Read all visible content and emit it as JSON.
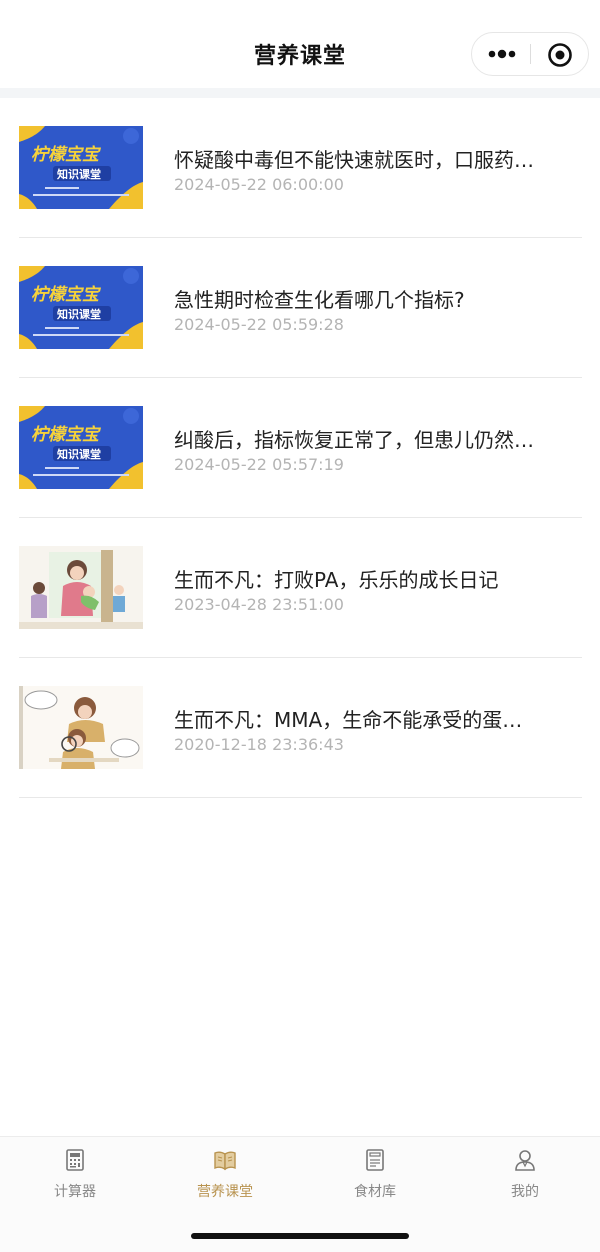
{
  "header": {
    "title": "营养课堂"
  },
  "list": {
    "items": [
      {
        "title": "怀疑酸中毒但不能快速就医时，口服药…",
        "date": "2024-05-22 06:00:00",
        "thumb": {
          "type": "banner",
          "text_main": "柠檬宝宝",
          "text_sub": "知识课堂"
        }
      },
      {
        "title": "急性期时检查生化看哪几个指标?",
        "date": "2024-05-22 05:59:28",
        "thumb": {
          "type": "banner",
          "text_main": "柠檬宝宝",
          "text_sub": "知识课堂"
        }
      },
      {
        "title": "纠酸后，指标恢复正常了，但患儿仍然…",
        "date": "2024-05-22 05:57:19",
        "thumb": {
          "type": "banner",
          "text_main": "柠檬宝宝",
          "text_sub": "知识课堂"
        }
      },
      {
        "title": "生而不凡：打败PA，乐乐的成长日记",
        "date": "2023-04-28 23:51:00",
        "thumb": {
          "type": "illustration"
        }
      },
      {
        "title": "生而不凡：MMA，生命不能承受的蛋…",
        "date": "2020-12-18 23:36:43",
        "thumb": {
          "type": "illustration"
        }
      }
    ]
  },
  "tabbar": {
    "tabs": [
      {
        "label": "计算器",
        "icon": "calculator-icon",
        "active": false
      },
      {
        "label": "营养课堂",
        "icon": "book-icon",
        "active": true
      },
      {
        "label": "食材库",
        "icon": "ingredients-icon",
        "active": false
      },
      {
        "label": "我的",
        "icon": "user-icon",
        "active": false
      }
    ]
  },
  "colors": {
    "active": "#b8934f",
    "inactive": "#888888",
    "banner_blue": "#2f58c9",
    "banner_yellow": "#f2c12e"
  }
}
